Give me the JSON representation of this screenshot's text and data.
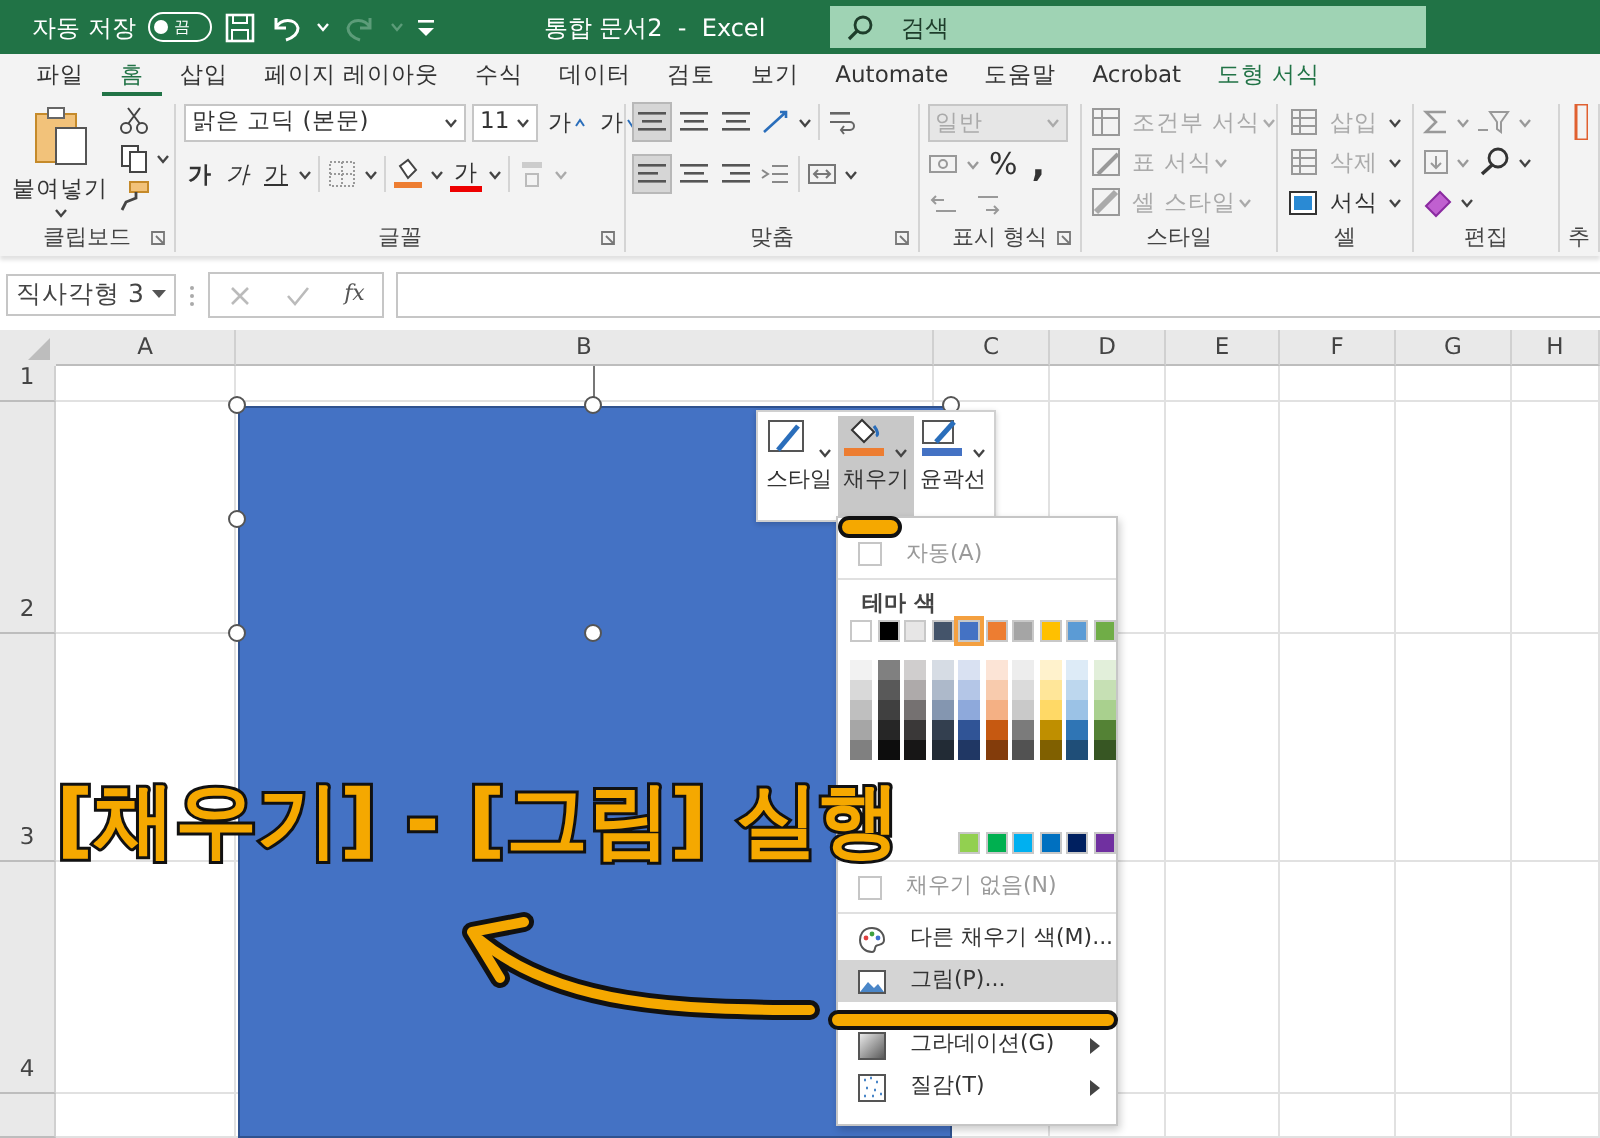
{
  "title_bar": {
    "autosave_label": "자동 저장",
    "autosave_toggle": {
      "label": "끔",
      "on": false
    },
    "document_title": "통합 문서2  -  Excel",
    "search": {
      "placeholder": "검색"
    }
  },
  "ribbon_tabs": [
    {
      "label": "파일",
      "selected": false,
      "kind": "normal"
    },
    {
      "label": "홈",
      "selected": true,
      "kind": "normal"
    },
    {
      "label": "삽입",
      "selected": false,
      "kind": "normal"
    },
    {
      "label": "페이지 레이아웃",
      "selected": false,
      "kind": "normal"
    },
    {
      "label": "수식",
      "selected": false,
      "kind": "normal"
    },
    {
      "label": "데이터",
      "selected": false,
      "kind": "normal"
    },
    {
      "label": "검토",
      "selected": false,
      "kind": "normal"
    },
    {
      "label": "보기",
      "selected": false,
      "kind": "normal"
    },
    {
      "label": "Automate",
      "selected": false,
      "kind": "normal"
    },
    {
      "label": "도움말",
      "selected": false,
      "kind": "normal"
    },
    {
      "label": "Acrobat",
      "selected": false,
      "kind": "normal"
    },
    {
      "label": "도형 서식",
      "selected": false,
      "kind": "contextual"
    }
  ],
  "ribbon": {
    "clipboard": {
      "paste_label": "붙여넣기",
      "group_label": "클립보드"
    },
    "font": {
      "font_name": "맑은 고딕 (본문)",
      "font_size": "11",
      "grow_label": "가",
      "shrink_label": "가",
      "bold_label": "가",
      "italic_label": "가",
      "underline_label": "가",
      "font_color_label": "가",
      "group_label": "글꼴"
    },
    "alignment": {
      "group_label": "맞춤"
    },
    "number": {
      "format": "일반",
      "format_disabled": true,
      "percent_label": "%",
      "comma_label": ",",
      "group_label": "표시 형식"
    },
    "styles": {
      "items": [
        {
          "kind": "conditional",
          "label": "조건부 서식",
          "disabled": true
        },
        {
          "kind": "table",
          "label": "표 서식",
          "disabled": true
        },
        {
          "kind": "cell_style",
          "label": "셀 스타일",
          "disabled": true
        }
      ],
      "group_label": "스타일"
    },
    "cells": {
      "items": [
        {
          "kind": "insert",
          "label": "삽입",
          "disabled": true
        },
        {
          "kind": "delete",
          "label": "삭제",
          "disabled": true
        },
        {
          "kind": "format",
          "label": "서식",
          "disabled": false
        }
      ],
      "group_label": "셀"
    },
    "editing": {
      "group_label": "편집"
    },
    "next_group_label": "추"
  },
  "formula_bar": {
    "name_box": "직사각형 3",
    "function_label": "fx"
  },
  "sheet": {
    "columns": [
      "A",
      "B",
      "C",
      "D",
      "E",
      "F",
      "G",
      "H"
    ],
    "rows": [
      "1",
      "2",
      "3",
      "4"
    ]
  },
  "mini_toolbar": {
    "buttons": [
      {
        "kind": "style",
        "label": "스타일",
        "selected": false
      },
      {
        "kind": "fill",
        "label": "채우기",
        "selected": true
      },
      {
        "kind": "outline",
        "label": "윤곽선",
        "selected": false
      }
    ]
  },
  "fill_menu": {
    "automatic": {
      "label": "자동(A)",
      "disabled": true
    },
    "theme_colors_label": "테마 색",
    "theme_colors": [
      {
        "color": "#ffffff",
        "selected": false,
        "shades": [
          {
            "color": "#f2f2f2"
          },
          {
            "color": "#d9d9d9"
          },
          {
            "color": "#bfbfbf"
          },
          {
            "color": "#a6a6a6"
          },
          {
            "color": "#808080"
          }
        ]
      },
      {
        "color": "#000000",
        "selected": false,
        "shades": [
          {
            "color": "#808080"
          },
          {
            "color": "#595959"
          },
          {
            "color": "#404040"
          },
          {
            "color": "#262626"
          },
          {
            "color": "#0d0d0d"
          }
        ]
      },
      {
        "color": "#e7e6e6",
        "selected": false,
        "shades": [
          {
            "color": "#d0cece"
          },
          {
            "color": "#aeaaaa"
          },
          {
            "color": "#757171"
          },
          {
            "color": "#3a3838"
          },
          {
            "color": "#171616"
          }
        ]
      },
      {
        "color": "#44546a",
        "selected": false,
        "shades": [
          {
            "color": "#d6dce4"
          },
          {
            "color": "#adb9ca"
          },
          {
            "color": "#8496b0"
          },
          {
            "color": "#333f4f"
          },
          {
            "color": "#222b35"
          }
        ]
      },
      {
        "color": "#4472c4",
        "selected": true,
        "shades": [
          {
            "color": "#d9e1f2"
          },
          {
            "color": "#b4c6e7"
          },
          {
            "color": "#8ea9db"
          },
          {
            "color": "#305496"
          },
          {
            "color": "#203764"
          }
        ]
      },
      {
        "color": "#ed7d31",
        "selected": false,
        "shades": [
          {
            "color": "#fce4d6"
          },
          {
            "color": "#f8cbad"
          },
          {
            "color": "#f4b084"
          },
          {
            "color": "#c65911"
          },
          {
            "color": "#833c0b"
          }
        ]
      },
      {
        "color": "#a5a5a5",
        "selected": false,
        "shades": [
          {
            "color": "#ededed"
          },
          {
            "color": "#dbdbdb"
          },
          {
            "color": "#c9c9c9"
          },
          {
            "color": "#7b7b7b"
          },
          {
            "color": "#525252"
          }
        ]
      },
      {
        "color": "#ffc000",
        "selected": false,
        "shades": [
          {
            "color": "#fff2cc"
          },
          {
            "color": "#ffe699"
          },
          {
            "color": "#ffd966"
          },
          {
            "color": "#bf8f00"
          },
          {
            "color": "#806000"
          }
        ]
      },
      {
        "color": "#5b9bd5",
        "selected": false,
        "shades": [
          {
            "color": "#ddebf7"
          },
          {
            "color": "#bdd7ee"
          },
          {
            "color": "#9bc2e6"
          },
          {
            "color": "#2f75b5"
          },
          {
            "color": "#1f4e78"
          }
        ]
      },
      {
        "color": "#70ad47",
        "selected": false,
        "shades": [
          {
            "color": "#e2efda"
          },
          {
            "color": "#c6e0b4"
          },
          {
            "color": "#a9d08e"
          },
          {
            "color": "#548235"
          },
          {
            "color": "#375623"
          }
        ]
      }
    ],
    "standard_colors": [
      {
        "color": "#92d050"
      },
      {
        "color": "#00b050"
      },
      {
        "color": "#00b0f0"
      },
      {
        "color": "#0070c0"
      },
      {
        "color": "#002060"
      },
      {
        "color": "#7030a0"
      }
    ],
    "items": [
      {
        "kind": "no_fill",
        "label": "채우기 없음(N)",
        "selected": false,
        "disabled": true,
        "submenu": false
      },
      {
        "kind": "more_colors",
        "label": "다른 채우기 색(M)...",
        "selected": false,
        "disabled": false,
        "submenu": false
      },
      {
        "kind": "picture",
        "label": "그림(P)...",
        "selected": true,
        "disabled": false,
        "submenu": false
      },
      {
        "kind": "gradient",
        "label": "그라데이션(G)",
        "selected": false,
        "disabled": false,
        "submenu": true
      },
      {
        "kind": "texture",
        "label": "질감(T)",
        "selected": false,
        "disabled": false,
        "submenu": true
      }
    ]
  },
  "annotation": {
    "text": "[채우기] - [그림] 실행"
  }
}
